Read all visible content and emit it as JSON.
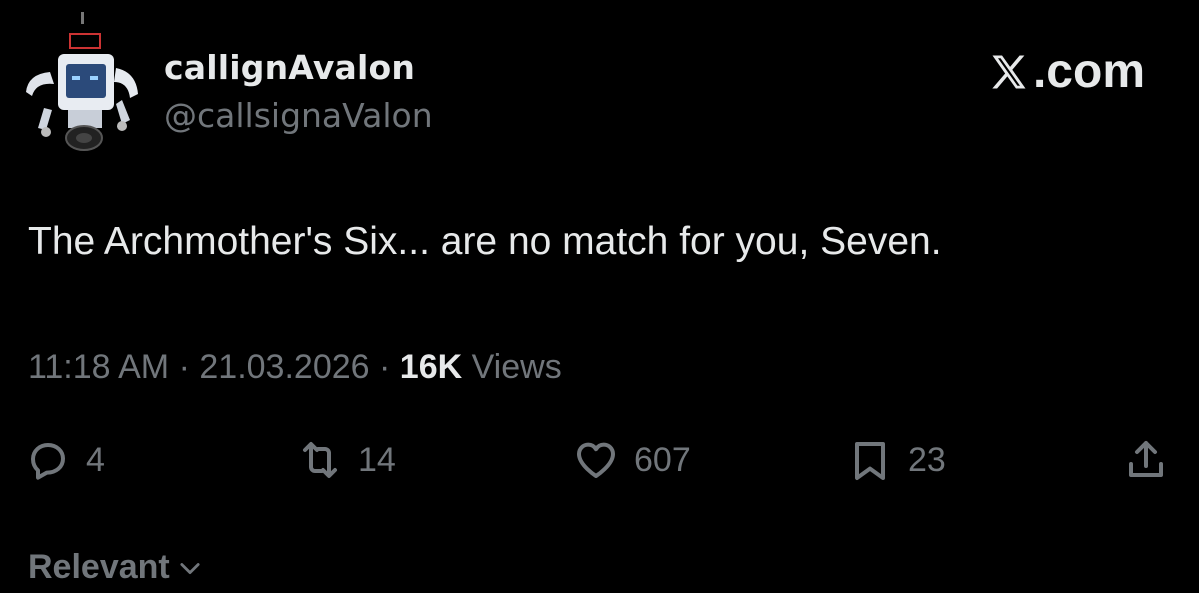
{
  "author": {
    "display_name": "callignAvalon",
    "handle": "@callsignaValon"
  },
  "brand": {
    "label": ".com",
    "icon": "x-logo-icon"
  },
  "tweet": {
    "text": "The Archmother's Six... are no match for you, Seven."
  },
  "meta": {
    "time": "11:18 AM",
    "separator": "·",
    "date": "21.03.2026",
    "views_count": "16K",
    "views_label": "Views"
  },
  "actions": {
    "reply": {
      "icon": "reply-icon",
      "count": "4"
    },
    "repost": {
      "icon": "repost-icon",
      "count": "14"
    },
    "like": {
      "icon": "heart-icon",
      "count": "607"
    },
    "bookmark": {
      "icon": "bookmark-icon",
      "count": "23"
    },
    "share": {
      "icon": "share-icon"
    }
  },
  "sort": {
    "label": "Relevant",
    "icon": "chevron-down-icon"
  },
  "colors": {
    "background": "#000000",
    "primary_text": "#e7e9ea",
    "secondary_text": "#71767b"
  }
}
